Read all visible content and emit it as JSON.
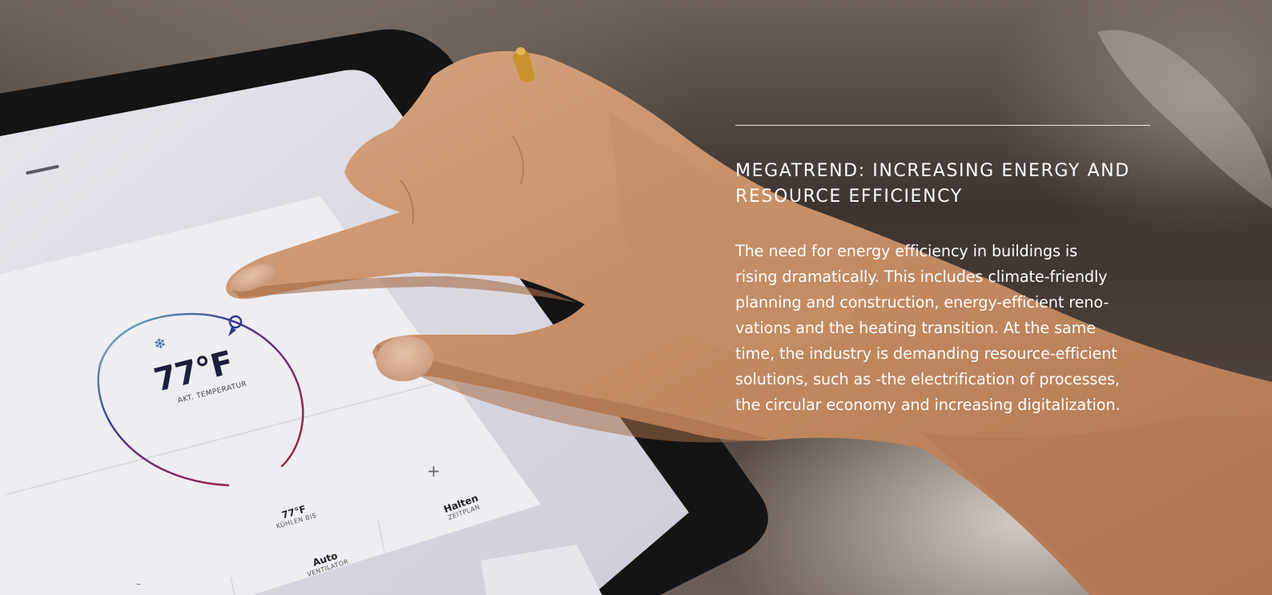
{
  "article": {
    "headline_lines": [
      "MEGATREND: INCREASING ENERGY AND",
      "RESOURCE EFFICIENCY"
    ],
    "body_lines": [
      "The need for energy efficiency in buildings is",
      "rising dramatically. This includes climate-friendly",
      "planning and construction, energy-efficient reno-",
      "vations and the heating transition. At the same",
      "time, the industry is demanding resource-efficient",
      "solutions, such as -the electrification of processes,",
      "the circular economy and increasing digitalization."
    ]
  },
  "thermostat": {
    "temperature": "77°F",
    "temperature_caption": "AKT. TEMPERATUR",
    "snowflake_icon": "snowflake-icon",
    "plus_symbol": "+",
    "minus_symbol": "–",
    "cooling": {
      "value": "77°F",
      "caption": "KÜHLEN BIS"
    },
    "hold": {
      "value": "Halten",
      "caption": "ZEITPLAN"
    },
    "fan": {
      "value": "Auto",
      "caption": "VENTILATOR"
    }
  },
  "colors": {
    "text_white": "#ffffff",
    "arc_blue": "#2b2f8a",
    "arc_red": "#b0202e",
    "arc_teal": "#7cc8c2",
    "screen_bg": "#dcdbe3",
    "card_bg": "#eeedf1",
    "tablet_frame": "#121212",
    "skin": "#c9936c"
  }
}
